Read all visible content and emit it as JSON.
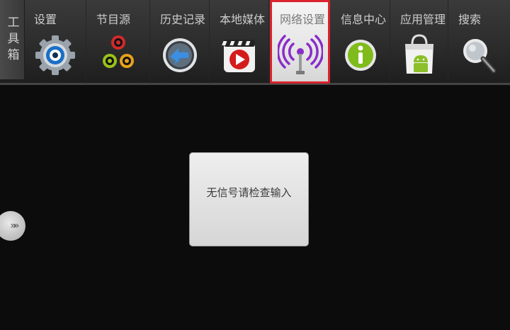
{
  "toolbox": {
    "label": "工具箱"
  },
  "toolbar": {
    "items": [
      {
        "label": "设置",
        "icon": "gear-icon"
      },
      {
        "label": "节目源",
        "icon": "source-dots-icon"
      },
      {
        "label": "历史记录",
        "icon": "history-icon"
      },
      {
        "label": "本地媒体",
        "icon": "media-play-icon"
      },
      {
        "label": "网络设置",
        "icon": "antenna-icon",
        "selected": true
      },
      {
        "label": "信息中心",
        "icon": "info-icon"
      },
      {
        "label": "应用管理",
        "icon": "android-bag-icon"
      },
      {
        "label": "搜索",
        "icon": "search-icon"
      }
    ]
  },
  "message": {
    "text": "无信号请检查输入"
  },
  "expand": {
    "glyph": "»»",
    "icon": "expand-arrows-icon"
  },
  "colors": {
    "selected_border": "#d9232e",
    "background": "#0c0c0c"
  }
}
